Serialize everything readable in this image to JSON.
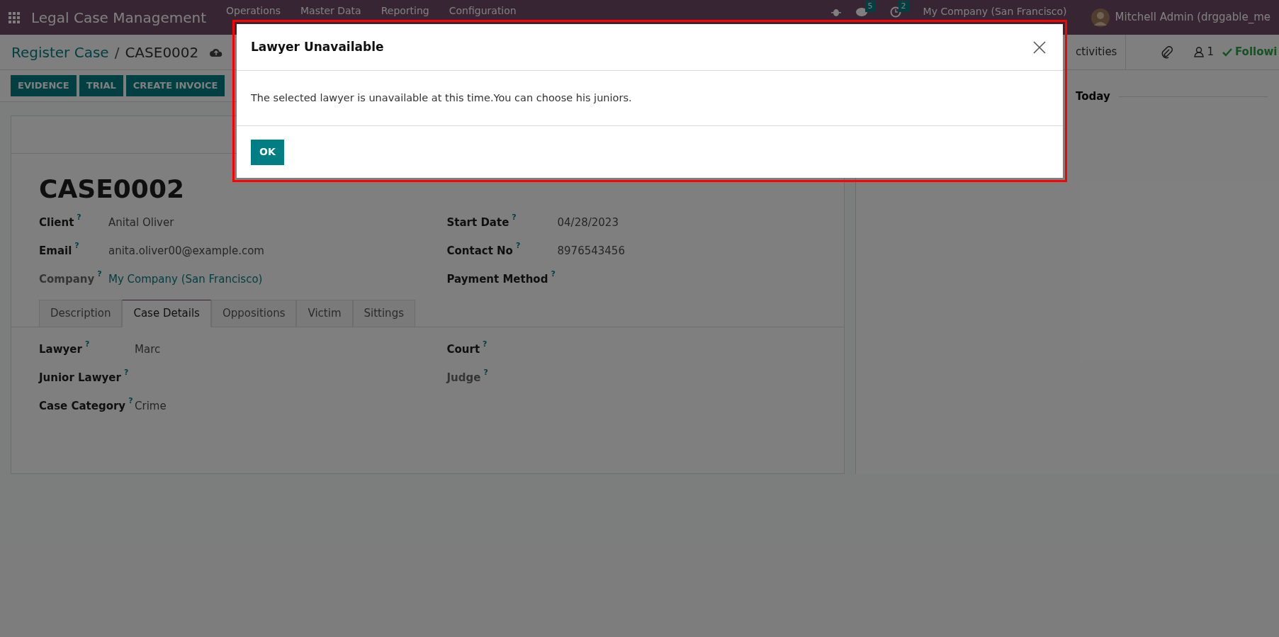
{
  "navbar": {
    "app_title": "Legal Case Management",
    "menu": [
      "Operations",
      "Master Data",
      "Reporting",
      "Configuration"
    ],
    "messages_badge": "5",
    "activities_badge": "2",
    "company": "My Company (San Francisco)",
    "user": "Mitchell Admin (drggable_me"
  },
  "breadcrumb": {
    "parent": "Register Case",
    "separator": "/",
    "current": "CASE0002"
  },
  "action_buttons": [
    "EVIDENCE",
    "TRIAL",
    "CREATE INVOICE"
  ],
  "chatter": {
    "activities": "ctivities",
    "followers_count": "1",
    "following": "Followi",
    "date_separator": "Today"
  },
  "form": {
    "title": "CASE0002",
    "left_fields": [
      {
        "label": "Client",
        "help": "?",
        "value": "Anital Oliver",
        "muted": false
      },
      {
        "label": "Email",
        "help": "?",
        "value": "anita.oliver00@example.com",
        "muted": false
      },
      {
        "label": "Company",
        "help": "?",
        "value": "My Company (San Francisco)",
        "muted": true,
        "link": true
      }
    ],
    "right_fields": [
      {
        "label": "Start Date",
        "help": "?",
        "value": "04/28/2023",
        "muted": false
      },
      {
        "label": "Contact No",
        "help": "?",
        "value": "8976543456",
        "muted": false
      },
      {
        "label": "Payment Method",
        "help": "?",
        "muted": false
      }
    ],
    "tabs": [
      {
        "label": "Description",
        "selected": false
      },
      {
        "label": "Case Details",
        "selected": true
      },
      {
        "label": "Oppositions",
        "selected": false
      },
      {
        "label": "Victim",
        "selected": false
      },
      {
        "label": "Sittings",
        "selected": false
      }
    ],
    "detail_left": [
      {
        "label": "Lawyer",
        "help": "?",
        "value": "Marc",
        "muted": false
      },
      {
        "label": "Junior Lawyer",
        "help": "?",
        "muted": false
      },
      {
        "label": "Case Category",
        "help": "?",
        "value": "Crime",
        "muted": false
      }
    ],
    "detail_right": [
      {
        "label": "Court",
        "help": "?",
        "muted": false
      },
      {
        "label": "Judge",
        "help": "?",
        "muted": true
      }
    ]
  },
  "dialog": {
    "title": "Lawyer Unavailable",
    "message": "The selected lawyer is unavailable at this time.You can choose his juniors.",
    "button": "OK"
  }
}
